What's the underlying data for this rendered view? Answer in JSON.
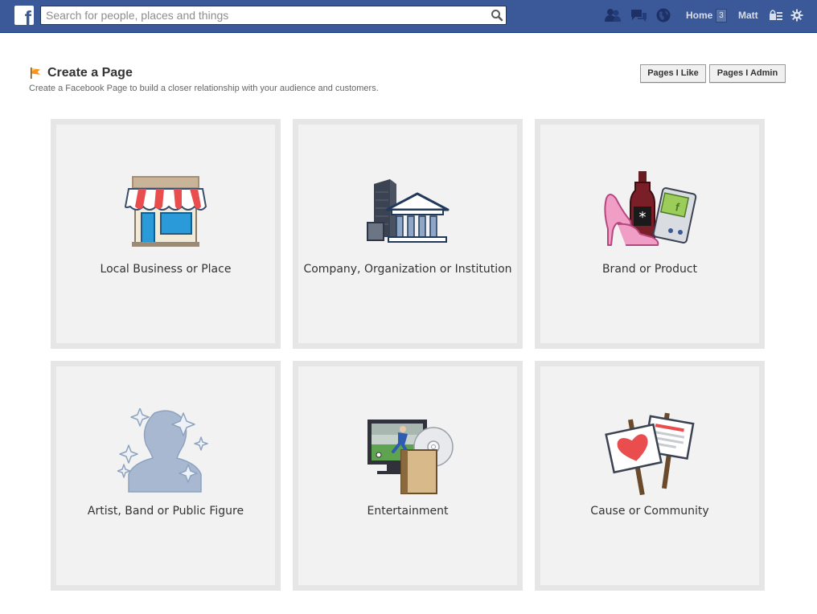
{
  "topbar": {
    "logo": "f",
    "search": {
      "placeholder": "Search for people, places and things",
      "value": ""
    },
    "home_label": "Home",
    "home_count": "3",
    "user_label": "Matt",
    "icons": [
      "friend-requests-icon",
      "messages-icon",
      "notifications-globe-icon",
      "privacy-lock-icon",
      "settings-gear-icon"
    ]
  },
  "header": {
    "title": "Create a Page",
    "subtitle": "Create a Facebook Page to build a closer relationship with your audience and customers.",
    "buttons": {
      "pages_like": "Pages I Like",
      "pages_admin": "Pages I Admin"
    }
  },
  "categories": [
    {
      "label": "Local Business or Place",
      "icon": "storefront-icon"
    },
    {
      "label": "Company, Organization or Institution",
      "icon": "buildings-icon"
    },
    {
      "label": "Brand or Product",
      "icon": "products-icon"
    },
    {
      "label": "Artist, Band or Public Figure",
      "icon": "public-figure-icon"
    },
    {
      "label": "Entertainment",
      "icon": "entertainment-icon"
    },
    {
      "label": "Cause or Community",
      "icon": "cause-signs-icon"
    }
  ],
  "colors": {
    "topbar": "#3b5998",
    "tile_border": "#e6e6e6",
    "tile_bg": "#f2f2f2",
    "accent_red": "#e94d4d"
  }
}
